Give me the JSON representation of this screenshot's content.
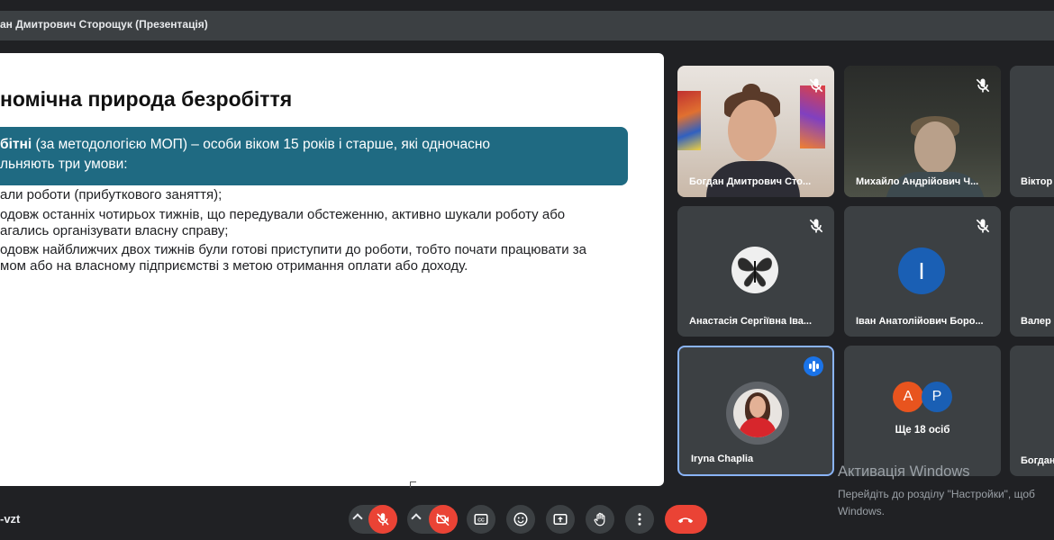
{
  "header": {
    "title": "ан Дмитрович Сторощук (Презентація)"
  },
  "slide": {
    "title": "номічна природа безробіття",
    "box_bold": "бітні",
    "box_rest": " (за методологією МОП) – особи віком 15 років і старше, які одночасно",
    "box_line2": "льняють три умови:",
    "bullets": [
      "али роботи (прибуткового заняття);",
      "одовж останніх чотирьох тижнів, що передували обстеженню, активно шукали роботу або",
      "агались організувати власну справу;",
      "одовж найближчих двох тижнів були готові приступити до роботи, тобто почати працювати за",
      "мом або на власному підприємстві з метою отримання оплати або доходу."
    ]
  },
  "participants": [
    {
      "name": "Богдан Дмитрович Сто...",
      "muted": true,
      "kind": "video"
    },
    {
      "name": "Михайло Андрійович Ч...",
      "muted": true,
      "kind": "video"
    },
    {
      "name": "Віктор",
      "muted": false,
      "kind": "partial"
    },
    {
      "name": "Анастасія Сергіївна Іва...",
      "muted": true,
      "kind": "avatar-image",
      "icon": "butterfly-icon"
    },
    {
      "name": "Іван Анатолійович Боро...",
      "muted": true,
      "kind": "avatar-letter",
      "letter": "I",
      "color": "#1a5fb4"
    },
    {
      "name": "Валер",
      "muted": false,
      "kind": "partial"
    },
    {
      "name": "Iryna Chaplia",
      "muted": false,
      "speaking": true,
      "kind": "avatar-photo"
    },
    {
      "name": "Ще 18 осіб",
      "kind": "more",
      "letters": [
        "A",
        "P"
      ],
      "colors": [
        "#e8541e",
        "#1a5fb4"
      ]
    },
    {
      "name": "Богдан",
      "muted": false,
      "kind": "partial"
    }
  ],
  "watermark": {
    "title": "Активація Windows",
    "line1": "Перейдіть до розділу \"Настройки\", щоб",
    "line2": "Windows."
  },
  "footer": {
    "meeting_code": "-vzt"
  },
  "colors": {
    "accent": "#8ab4f8",
    "danger": "#ea4335",
    "slide_box": "#1f6a82"
  }
}
